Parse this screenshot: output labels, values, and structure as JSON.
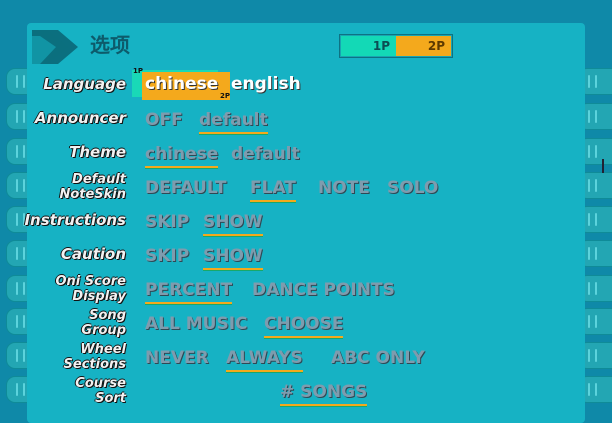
{
  "header": {
    "title": "选项",
    "players": [
      "1P",
      "2P"
    ]
  },
  "language_cursor": {
    "p1_tag": "1P",
    "p2_tag": "2P"
  },
  "rows": [
    {
      "label": "Language",
      "options": [
        "chinese",
        "english"
      ]
    },
    {
      "label": "Announcer",
      "options": [
        "OFF",
        "default"
      ]
    },
    {
      "label": "Theme",
      "options": [
        "chinese",
        "default"
      ]
    },
    {
      "label": "Default\nNoteSkin",
      "options": [
        "DEFAULT",
        "FLAT",
        "NOTE",
        "SOLO"
      ]
    },
    {
      "label": "Instructions",
      "options": [
        "SKIP",
        "SHOW"
      ]
    },
    {
      "label": "Caution",
      "options": [
        "SKIP",
        "SHOW"
      ]
    },
    {
      "label": "Oni Score\nDisplay",
      "options": [
        "PERCENT",
        "DANCE POINTS"
      ]
    },
    {
      "label": "Song\nGroup",
      "options": [
        "ALL MUSIC",
        "CHOOSE"
      ]
    },
    {
      "label": "Wheel\nSections",
      "options": [
        "NEVER",
        "ALWAYS",
        "ABC ONLY"
      ]
    },
    {
      "label": "Course\nSort",
      "options": [
        "# SONGS"
      ]
    }
  ]
}
